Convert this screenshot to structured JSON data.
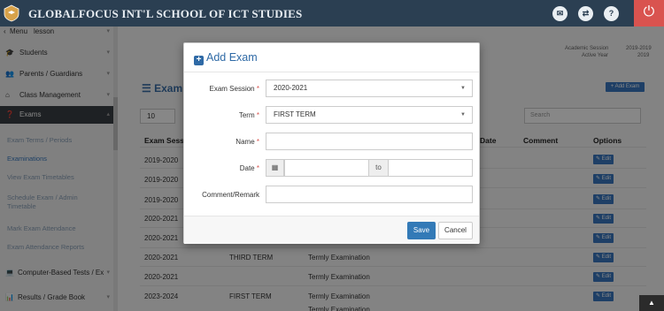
{
  "topbar": {
    "school_name": "GLOBALFOCUS INT'L SCHOOL OF ICT STUDIES",
    "color": "#2b3f52",
    "icons": [
      "envelope-icon",
      "share-icon",
      "help-icon",
      "power-icon"
    ],
    "power_color": "#d9534f"
  },
  "sidebar": {
    "menu_label": "Menu",
    "menu_search": "lesson",
    "items": [
      {
        "label": "Students"
      },
      {
        "label": "Parents / Guardians"
      },
      {
        "label": "Class Management"
      },
      {
        "label": "Exams"
      }
    ],
    "exam_sub": [
      "Exam Terms / Periods",
      "Examinations",
      "View Exam Timetables",
      "Schedule Exam / Admin Timetable",
      "Mark Exam Attendance",
      "Exam Attendance Reports"
    ],
    "bottom_items": [
      {
        "label": "Computer-Based Tests / Ex"
      },
      {
        "label": "Results / Grade Book"
      }
    ]
  },
  "main": {
    "session_label": "Academic Session",
    "session_value": "2019-2019",
    "year_label": "Active Year",
    "year_value": "2019",
    "panel_title": "Examinations",
    "add_exam_button": "Add Exam",
    "page_length": "10",
    "search_placeholder": "Search",
    "table": {
      "headers": [
        "Exam Session",
        "Date",
        "Comment",
        "Options"
      ],
      "rows": [
        {
          "session": "2019-2020",
          "term": "",
          "type": ""
        },
        {
          "session": "2019-2020",
          "term": "",
          "type": ""
        },
        {
          "session": "2019-2020",
          "term": "",
          "type": ""
        },
        {
          "session": "2020-2021",
          "term": "",
          "type": ""
        },
        {
          "session": "2020-2021",
          "term": "",
          "type": ""
        },
        {
          "session": "2020-2021",
          "term": "THIRD TERM",
          "type": "Termly Examination"
        },
        {
          "session": "2020-2021",
          "term": "",
          "type": "Termly Examination"
        },
        {
          "session": "2023-2024",
          "term": "FIRST TERM",
          "type": "Termly Examination"
        },
        {
          "session": "",
          "term": "",
          "type": "Termly Examination"
        }
      ],
      "edit_label": "Edit"
    }
  },
  "modal": {
    "title": "Add Exam",
    "fields": {
      "exam_session_label": "Exam Session",
      "exam_session_value": "2020-2021",
      "term_label": "Term",
      "term_value": "FIRST TERM",
      "name_label": "Name",
      "name_value": "",
      "date_label": "Date",
      "date_from": "",
      "date_sep": "to",
      "date_to": "",
      "comment_label": "Comment/Remark",
      "comment_value": ""
    },
    "save_button": "Save",
    "cancel_button": "Cancel"
  }
}
